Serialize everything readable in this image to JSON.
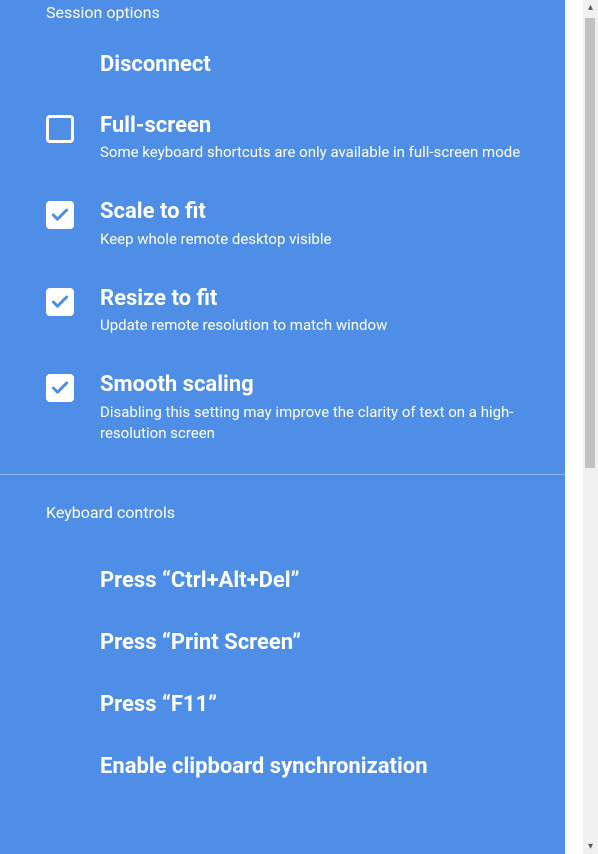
{
  "colors": {
    "panel_bg": "#4e8ee6",
    "text": "#ffffff"
  },
  "session": {
    "header": "Session options",
    "disconnect": {
      "label": "Disconnect"
    },
    "fullscreen": {
      "label": "Full-screen",
      "desc": "Some keyboard shortcuts are only available in full-screen mode",
      "checked": false
    },
    "scale": {
      "label": "Scale to fit",
      "desc": "Keep whole remote desktop visible",
      "checked": true
    },
    "resize": {
      "label": "Resize to fit",
      "desc": "Update remote resolution to match window",
      "checked": true
    },
    "smooth": {
      "label": "Smooth scaling",
      "desc": "Disabling this setting may improve the clarity of text on a high-resolution screen",
      "checked": true
    }
  },
  "keyboard": {
    "header": "Keyboard controls",
    "ctrl_alt_del": {
      "label": "Press “Ctrl+Alt+Del”"
    },
    "print_screen": {
      "label": "Press “Print Screen”"
    },
    "f11": {
      "label": "Press “F11”"
    },
    "clipboard": {
      "label": "Enable clipboard synchronization"
    }
  }
}
